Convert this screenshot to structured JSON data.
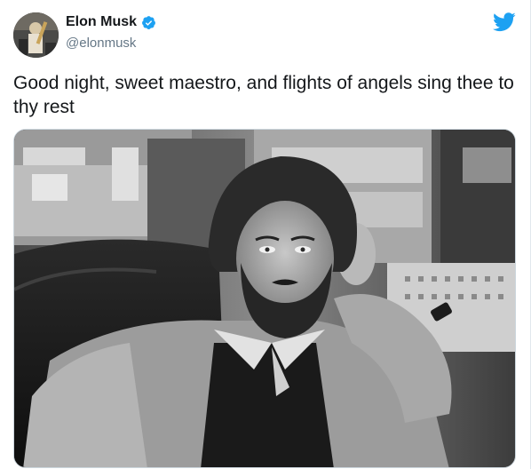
{
  "author": {
    "name": "Elon Musk",
    "handle": "@elonmusk",
    "verified": true
  },
  "tweet": {
    "text": "Good night, sweet maestro, and flights of angels sing thee to thy rest"
  },
  "icons": {
    "verified": "verified-badge-icon",
    "brand": "twitter-bird-icon"
  },
  "colors": {
    "twitter_blue": "#1da1f2",
    "name": "#14171a",
    "handle": "#657786"
  }
}
